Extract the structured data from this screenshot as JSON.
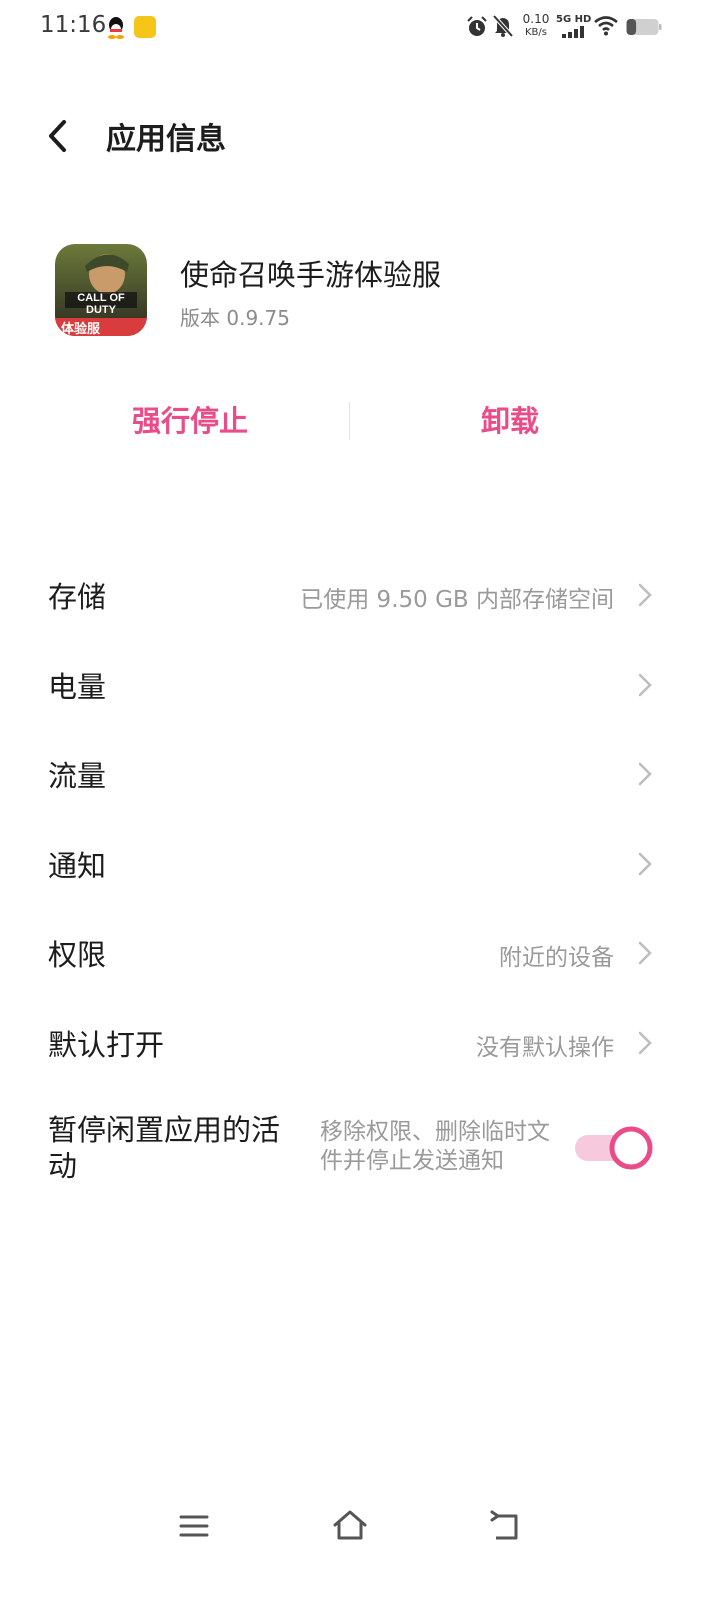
{
  "status_bar": {
    "time": "11:16",
    "net_speed_value": "0.10",
    "net_speed_unit": "KB/s",
    "network_badge": "5G HD",
    "battery_level": 0.3
  },
  "header": {
    "title": "应用信息"
  },
  "app": {
    "name": "使命召唤手游体验服",
    "version": "版本 0.9.75",
    "icon_caption": "体验服",
    "icon_brand": "CALL OF DUTY"
  },
  "actions": {
    "force_stop": "强行停止",
    "uninstall": "卸载"
  },
  "rows": [
    {
      "label": "存储",
      "value": "已使用 9.50 GB 内部存储空间"
    },
    {
      "label": "电量",
      "value": ""
    },
    {
      "label": "流量",
      "value": ""
    },
    {
      "label": "通知",
      "value": ""
    },
    {
      "label": "权限",
      "value": "附近的设备"
    },
    {
      "label": "默认打开",
      "value": "没有默认操作"
    }
  ],
  "idle_row": {
    "label": "暂停闲置应用的活动",
    "description": "移除权限、删除临时文件并停止发送通知",
    "enabled": true
  },
  "colors": {
    "accent": "#ea4c89",
    "toggle_track": "#f7c9dc"
  }
}
